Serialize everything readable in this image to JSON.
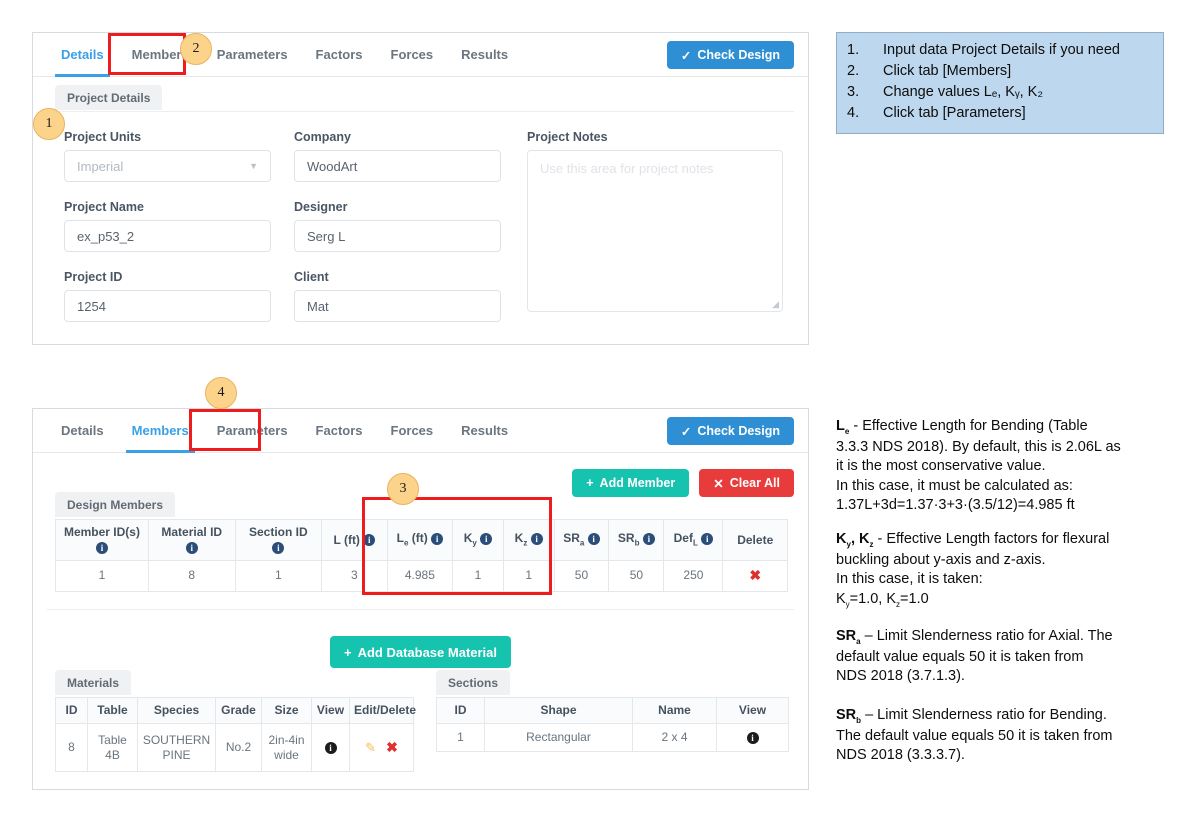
{
  "steps": {
    "items": [
      {
        "num": "1.",
        "text": "Input data Project Details if you need"
      },
      {
        "num": "2.",
        "text": "Click tab [Members]"
      },
      {
        "num": "3.",
        "text": "Change values Lₑ, Kᵧ, K₂"
      },
      {
        "num": "4.",
        "text": "Click tab [Parameters]"
      }
    ]
  },
  "notes": [
    {
      "key": "le",
      "symbol": "L",
      "sub": "e",
      "lines": [
        " - Effective Length for Bending (Table",
        "3.3.3 NDS 2018). By default, this is 2.06L as",
        "it is the most conservative value.",
        "In this case, it must be calculated as:",
        "1.37L+3d=1.37·3+3·(3.5/12)=4.985 ft"
      ]
    },
    {
      "key": "k",
      "lines": [
        " - Effective Length factors for flexural",
        "buckling about y-axis and z-axis.",
        "In this case, it is taken:",
        "Kᵧ=1.0, K₂=1.0"
      ]
    },
    {
      "key": "sra",
      "symbol": "SR",
      "sub": "a",
      "lines": [
        " – Limit Slenderness ratio for Axial. The",
        "default value equals 50 it is taken from",
        "NDS 2018 (3.7.1.3)."
      ]
    },
    {
      "key": "srb",
      "symbol": "SR",
      "sub": "b",
      "lines": [
        " – Limit Slenderness ratio for Bending.",
        "The default value equals 50 it is taken from",
        "NDS 2018 (3.3.3.7)."
      ]
    }
  ],
  "panel_details": {
    "tabs": [
      {
        "label": "Details",
        "active": true
      },
      {
        "label": "Members",
        "active": false
      },
      {
        "label": "Parameters",
        "active": false
      },
      {
        "label": "Factors",
        "active": false
      },
      {
        "label": "Forces",
        "active": false
      },
      {
        "label": "Results",
        "active": false
      }
    ],
    "check_design_label": "Check Design",
    "subtab_label": "Project Details",
    "fields": {
      "project_units": {
        "label": "Project Units",
        "value": "Imperial",
        "disabled": true
      },
      "company": {
        "label": "Company",
        "value": "WoodArt"
      },
      "project_notes": {
        "label": "Project Notes",
        "placeholder": "Use this area for project notes"
      },
      "project_name": {
        "label": "Project Name",
        "value": "ex_p53_2"
      },
      "designer": {
        "label": "Designer",
        "value": "Serg L"
      },
      "project_id": {
        "label": "Project ID",
        "value": "1254"
      },
      "client": {
        "label": "Client",
        "value": "Mat"
      }
    }
  },
  "panel_members": {
    "tabs": [
      {
        "label": "Details",
        "active": false
      },
      {
        "label": "Members",
        "active": true
      },
      {
        "label": "Parameters",
        "active": false
      },
      {
        "label": "Factors",
        "active": false
      },
      {
        "label": "Forces",
        "active": false
      },
      {
        "label": "Results",
        "active": false
      }
    ],
    "check_design_label": "Check Design",
    "add_member_label": "Add Member",
    "clear_all_label": "Clear All",
    "add_database_material_label": "Add Database Material",
    "design_members": {
      "subtab_label": "Design Members",
      "columns": [
        {
          "label": "Member ID(s)",
          "sub": "",
          "info": true,
          "stacked": true
        },
        {
          "label": "Material ID",
          "sub": "",
          "info": true,
          "stacked": true
        },
        {
          "label": "Section ID",
          "sub": "",
          "info": true,
          "stacked": true
        },
        {
          "label": "L (ft)",
          "sub": "",
          "info": true,
          "stacked": false
        },
        {
          "label": "L",
          "sub": "e",
          "suffix": " (ft)",
          "info": true,
          "stacked": false
        },
        {
          "label": "K",
          "sub": "y",
          "suffix": "",
          "info": true,
          "stacked": false
        },
        {
          "label": "K",
          "sub": "z",
          "suffix": "",
          "info": true,
          "stacked": false
        },
        {
          "label": "SR",
          "sub": "a",
          "suffix": "",
          "info": true,
          "stacked": false
        },
        {
          "label": "SR",
          "sub": "b",
          "suffix": "",
          "info": true,
          "stacked": false
        },
        {
          "label": "Def",
          "sub": "L",
          "suffix": "",
          "info": true,
          "stacked": false
        },
        {
          "label": "Delete",
          "sub": "",
          "info": false,
          "stacked": false
        }
      ],
      "rows": [
        {
          "member_ids": "1",
          "material_id": "8",
          "section_id": "1",
          "l": "3",
          "le": "4.985",
          "ky": "1",
          "kz": "1",
          "sra": "50",
          "srb": "50",
          "defl": "250",
          "delete": "✖"
        }
      ]
    },
    "materials": {
      "subtab_label": "Materials",
      "columns": [
        "ID",
        "Table",
        "Species",
        "Grade",
        "Size",
        "View",
        "Edit/Delete"
      ],
      "rows": [
        {
          "id": "8",
          "table": "Table 4B",
          "species": "SOUTHERN PINE",
          "grade": "No.2",
          "size": "2in-4in wide",
          "view": "i",
          "edit": "✎",
          "delete": "✖"
        }
      ]
    },
    "sections": {
      "subtab_label": "Sections",
      "columns": [
        "ID",
        "Shape",
        "Name",
        "View"
      ],
      "rows": [
        {
          "id": "1",
          "shape": "Rectangular",
          "name": "2 x 4",
          "view": "i"
        }
      ]
    }
  },
  "annotations": {
    "badges": [
      "1",
      "2",
      "3",
      "4"
    ]
  },
  "colors": {
    "accent_blue": "#3aa0e8",
    "button_blue": "#2e8fd4",
    "teal": "#15c3ae",
    "red": "#e83b3b",
    "highlight_red": "#ee1c1c",
    "badge_amber": "#fbd38a",
    "steps_bg": "#bdd7ee"
  }
}
